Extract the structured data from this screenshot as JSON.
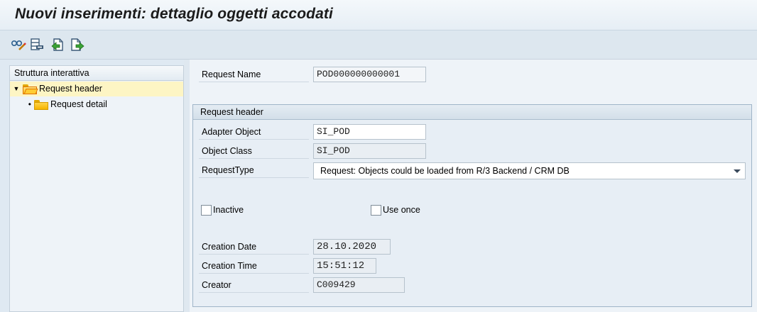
{
  "title": "Nuovi inserimenti: dettaglio oggetti accodati",
  "toolbar": {
    "buttons": [
      "glasses-pencil-icon",
      "table-delete-icon",
      "document-back-icon",
      "document-forward-icon"
    ]
  },
  "tree": {
    "header": "Struttura interattiva",
    "items": [
      {
        "label": "Request header",
        "expander": "▼",
        "selected": true,
        "icon": "open-folder-icon"
      },
      {
        "label": "Request detail",
        "expander": "•",
        "selected": false,
        "icon": "folder-icon"
      }
    ]
  },
  "request": {
    "name_label": "Request Name",
    "name_value": "POD000000000001"
  },
  "group": {
    "title": "Request header",
    "adapter_object_label": "Adapter Object",
    "adapter_object_value": "SI_POD",
    "object_class_label": "Object Class",
    "object_class_value": "SI_POD",
    "request_type_label": "RequestType",
    "request_type_value": "Request: Objects could be loaded from R/3 Backend / CRM DB",
    "inactive_label": "Inactive",
    "inactive_checked": false,
    "use_once_label": "Use once",
    "use_once_checked": false,
    "creation_date_label": "Creation Date",
    "creation_date_value": "28.10.2020",
    "creation_time_label": "Creation Time",
    "creation_time_value": "15:51:12",
    "creator_label": "Creator",
    "creator_value": "C009429"
  }
}
